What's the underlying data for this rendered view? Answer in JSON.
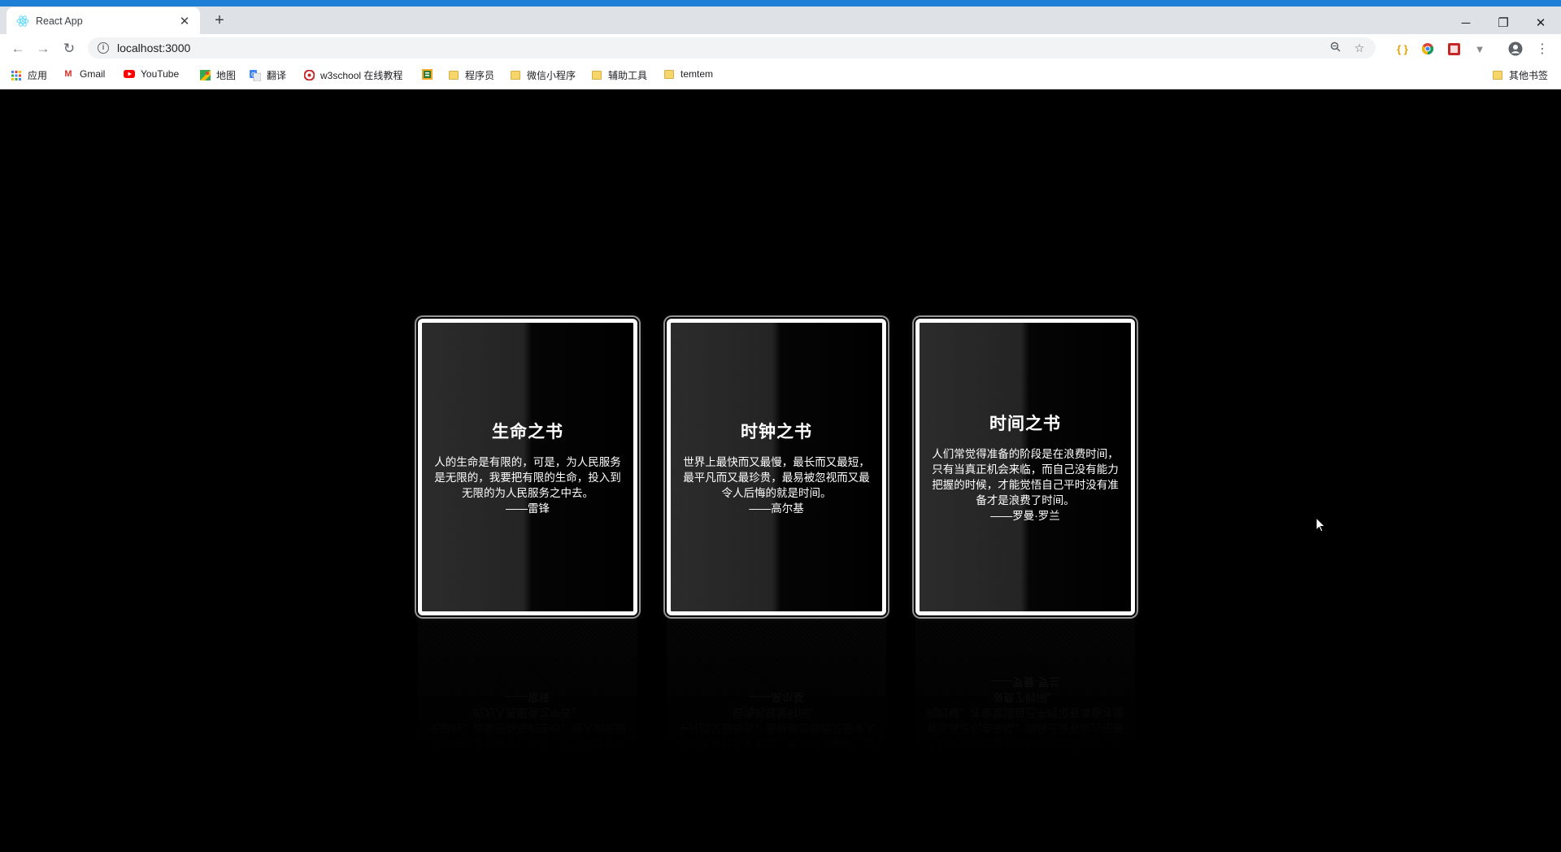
{
  "browser": {
    "tab_title": "React App",
    "tab_close": "✕",
    "new_tab": "+",
    "window": {
      "minimize": "─",
      "restore": "❐",
      "close": "✕"
    },
    "url": "localhost:3000",
    "bookmarks": [
      {
        "label": "应用",
        "icon": "apps-grid-icon"
      },
      {
        "label": "Gmail",
        "icon": "gmail-icon"
      },
      {
        "label": "YouTube",
        "icon": "youtube-icon"
      },
      {
        "label": "地图",
        "icon": "maps-icon"
      },
      {
        "label": "翻译",
        "icon": "translate-icon"
      },
      {
        "label": "w3school 在线教程",
        "icon": "w3school-icon"
      },
      {
        "label": "",
        "icon": "notebook-icon"
      },
      {
        "label": "程序员",
        "icon": "folder-icon"
      },
      {
        "label": "微信小程序",
        "icon": "folder-icon"
      },
      {
        "label": "辅助工具",
        "icon": "folder-icon"
      },
      {
        "label": "temtem",
        "icon": "folder-icon"
      }
    ],
    "other_bookmarks": "其他书签"
  },
  "cards": [
    {
      "title": "生命之书",
      "text": "人的生命是有限的，可是，为人民服务是无限的，我要把有限的生命，投入到无限的为人民服务之中去。",
      "author": "——雷锋"
    },
    {
      "title": "时钟之书",
      "text": "世界上最快而又最慢，最长而又最短，最平凡而又最珍贵，最易被忽视而又最令人后悔的就是时间。",
      "author": "——高尔基"
    },
    {
      "title": "时间之书",
      "text": "人们常觉得准备的阶段是在浪费时间，只有当真正机会来临，而自己没有能力把握的时候，才能觉悟自己平时没有准备才是浪费了时间。",
      "author": "——罗曼·罗兰"
    }
  ],
  "colors": {
    "page_bg": "#000000",
    "card_border": "#ffffff",
    "card_text": "#ffffff"
  }
}
